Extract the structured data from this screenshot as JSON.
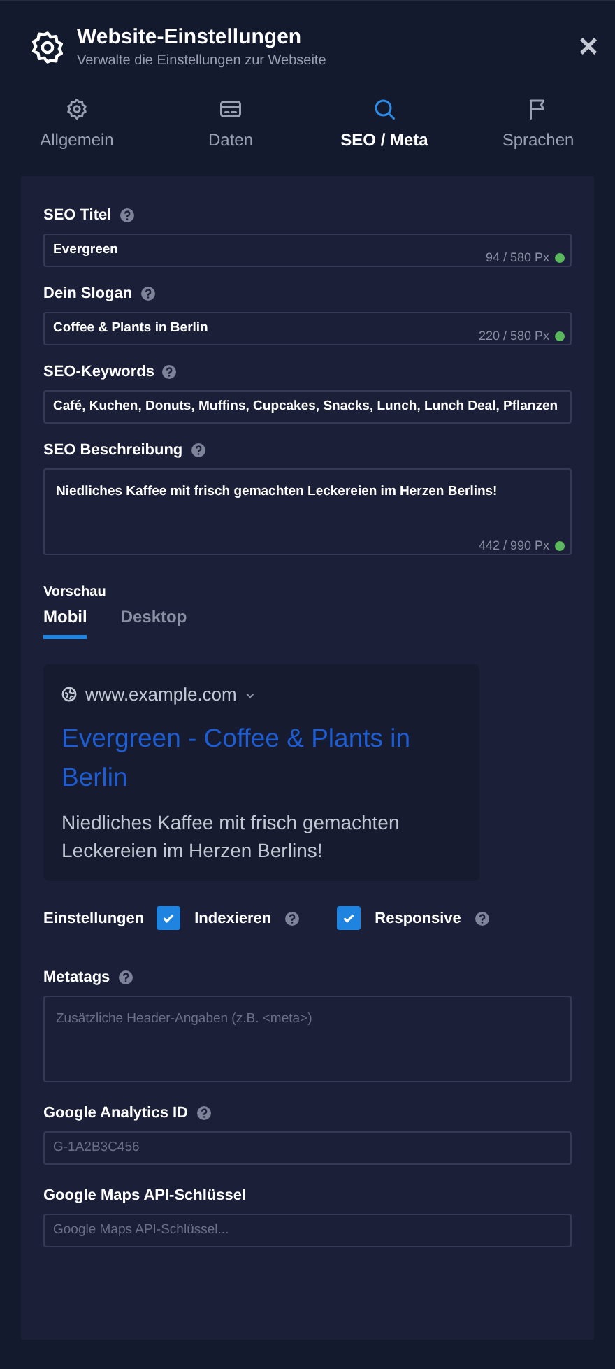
{
  "header": {
    "title": "Website-Einstellungen",
    "subtitle": "Verwalte die Einstellungen zur Webseite",
    "close": "×"
  },
  "tabs": [
    {
      "label": "Allgemein",
      "selected": false
    },
    {
      "label": "Daten",
      "selected": false
    },
    {
      "label": "SEO / Meta",
      "selected": true
    },
    {
      "label": "Sprachen",
      "selected": false
    }
  ],
  "seo_fields": [
    {
      "kind": "text",
      "label": "SEO Titel",
      "help": true,
      "value": "Evergreen",
      "counter": {
        "text": "94 / 580 Px",
        "color": "#5cb85c"
      }
    },
    {
      "kind": "text",
      "label": "Dein Slogan",
      "help": true,
      "value": "Coffee & Plants in Berlin",
      "counter": {
        "text": "220 / 580 Px",
        "color": "#5cb85c"
      }
    },
    {
      "kind": "text",
      "label": "SEO-Keywords",
      "help": true,
      "value": "Café, Kuchen, Donuts, Muffins, Cupcakes, Snacks, Lunch, Lunch Deal, Pflanzen"
    },
    {
      "kind": "textarea",
      "label": "SEO Beschreibung",
      "help": true,
      "value": "Niedliches Kaffee mit frisch gemachten Leckereien im Herzen Berlins!",
      "counter": {
        "text": "442 / 990 Px",
        "color": "#5cb85c"
      }
    }
  ],
  "preview": {
    "label": "Vorschau",
    "tabs": [
      {
        "label": "Mobil",
        "selected": true
      },
      {
        "label": "Desktop",
        "selected": false
      }
    ],
    "url": "www.example.com",
    "title": "Evergreen - Coffee & Plants in Berlin",
    "description": "Niedliches Kaffee mit frisch gemachten Leckereien im Herzen Berlins!"
  },
  "settings": {
    "label": "Einstellungen",
    "options": [
      {
        "label": "Indexieren",
        "checked": true,
        "help": true
      },
      {
        "label": "Responsive",
        "checked": true,
        "help": true
      }
    ]
  },
  "extra_fields": [
    {
      "kind": "textarea",
      "label": "Metatags",
      "help": true,
      "placeholder": "Zusätzliche Header-Angaben (z.B. <meta>)"
    },
    {
      "kind": "text",
      "label": "Google Analytics ID",
      "help": true,
      "placeholder": "G-1A2B3C456"
    },
    {
      "kind": "text",
      "label": "Google Maps API-Schlüssel",
      "help": false,
      "placeholder": "Google Maps API-Schlüssel..."
    }
  ]
}
